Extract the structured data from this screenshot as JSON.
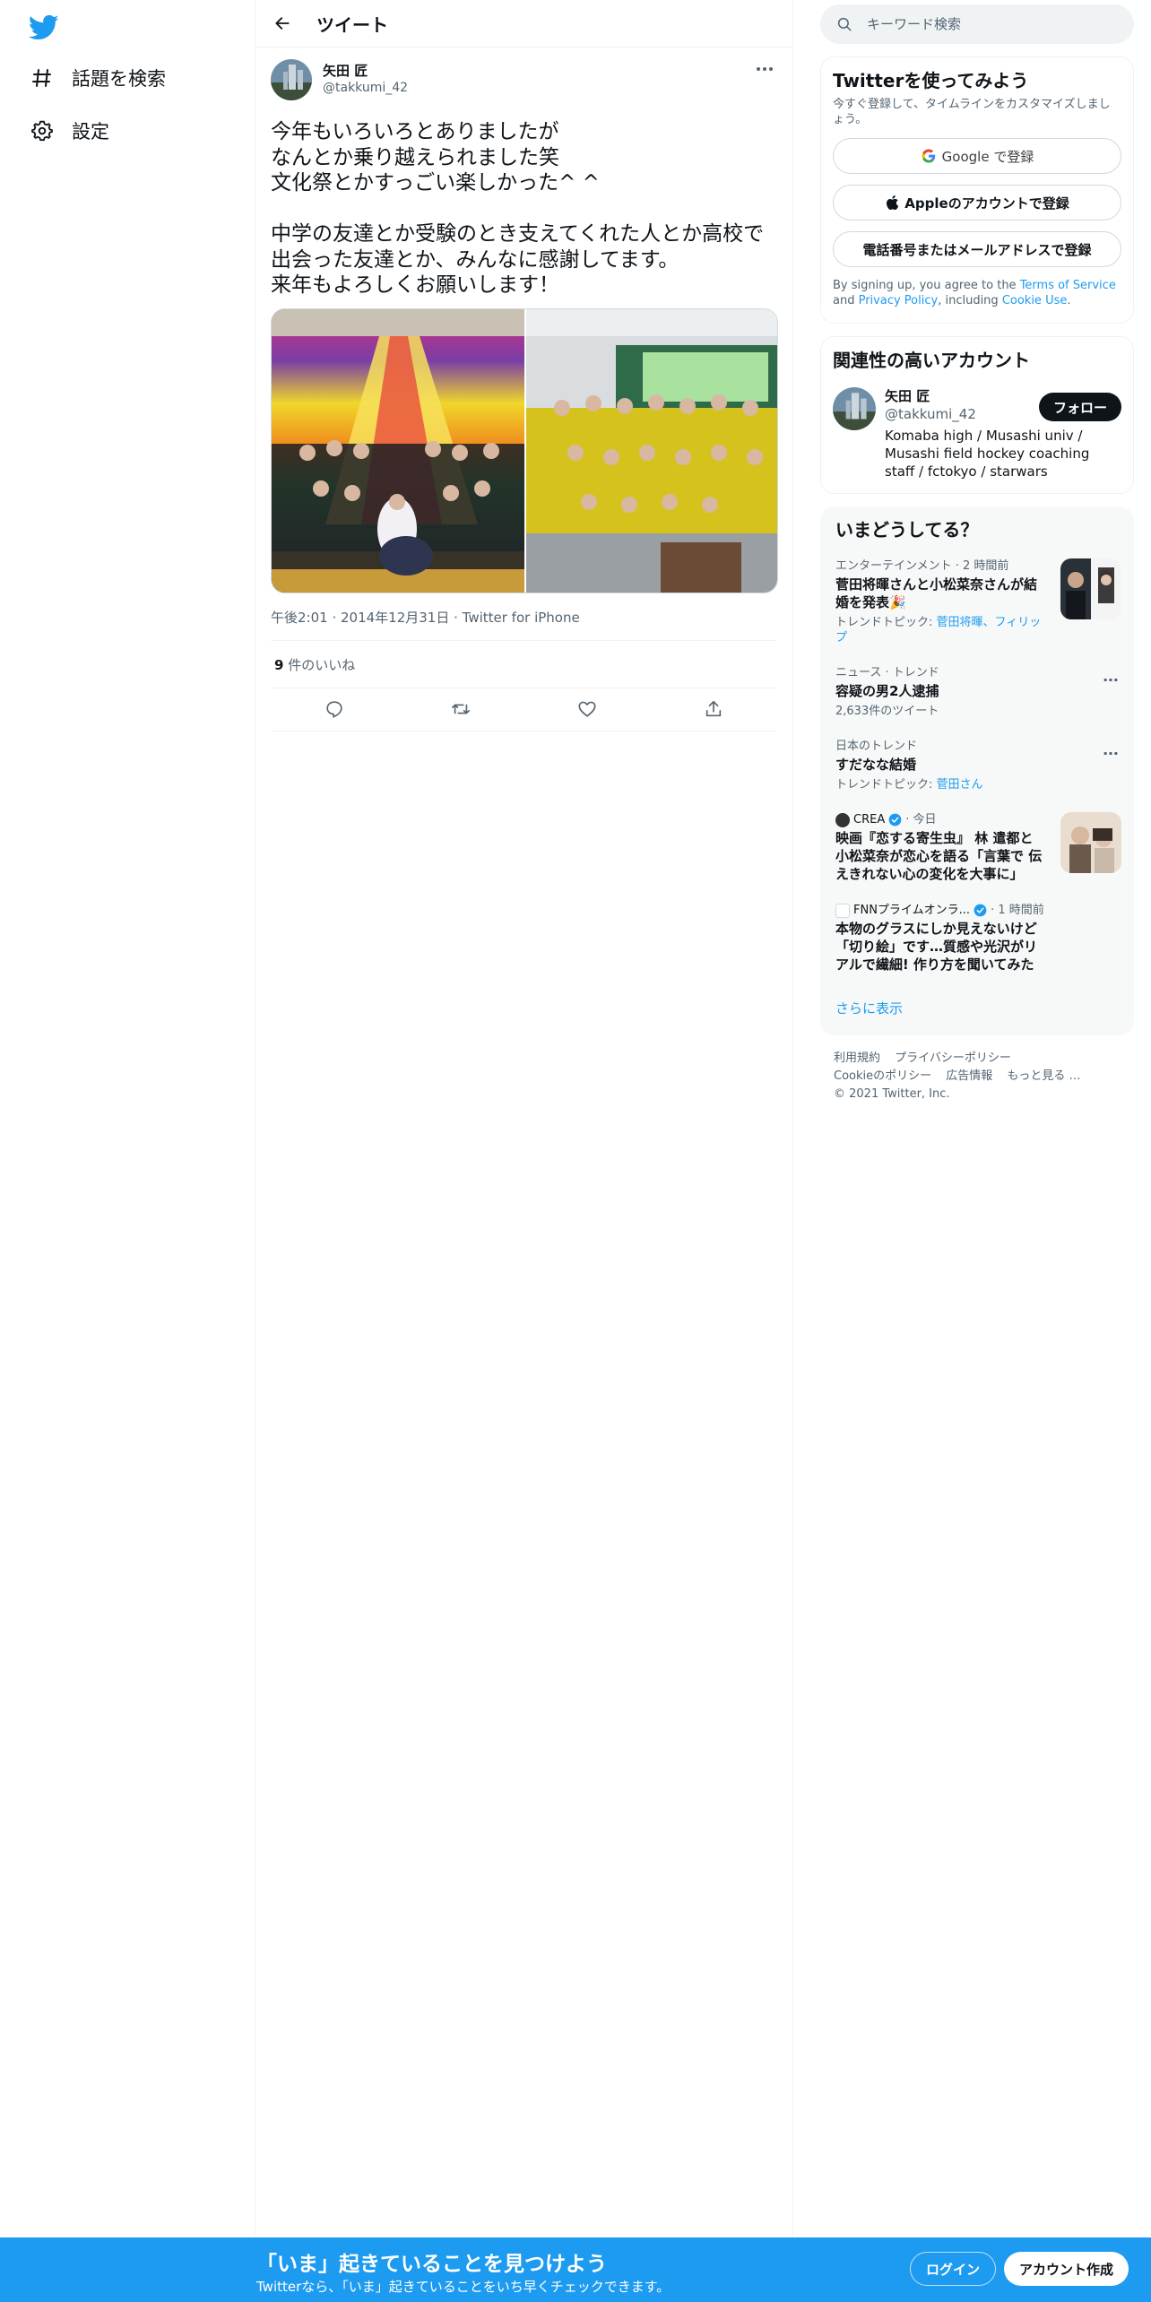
{
  "nav": {
    "logo_icon": "twitter-bird-icon",
    "items": [
      {
        "label": "話題を検索",
        "icon": "hashtag-icon"
      },
      {
        "label": "設定",
        "icon": "gear-icon"
      }
    ]
  },
  "main": {
    "header_title": "ツイート",
    "tweet": {
      "author_name": "矢田 匠",
      "author_handle": "@takkumi_42",
      "text": "今年もいろいろとありましたが\nなんとか乗り越えられました笑\n文化祭とかすっごい楽しかった^ ^\n\n中学の友達とか受験のとき支えてくれた人とか高校で出会った友達とか、みんなに感謝してます。\n来年もよろしくお願いします！",
      "timestamp": "午後2:01 · 2014年12月31日 · Twitter for iPhone",
      "likes_count": "9",
      "likes_label": " 件のいいね"
    }
  },
  "right": {
    "search_placeholder": "キーワード検索",
    "signup": {
      "title": "Twitterを使ってみよう",
      "subtitle": "今すぐ登録して、タイムラインをカスタマイズしましょう。",
      "google_label": "Google で登録",
      "apple_label": "Appleのアカウントで登録",
      "phone_label": "電話番号またはメールアドレスで登録",
      "legal_prefix": "By signing up, you agree to the ",
      "terms": "Terms of Service",
      "and": " and ",
      "privacy": "Privacy Policy",
      "including": ", including ",
      "cookie": "Cookie Use",
      "period": "."
    },
    "relevant": {
      "title": "関連性の高いアカウント",
      "name": "矢田 匠",
      "handle": "@takkumi_42",
      "bio": "Komaba high / Musashi univ / Musashi field hockey coaching staff / fctokyo / starwars",
      "follow_label": "フォロー"
    },
    "trends": {
      "title": "いまどうしてる？",
      "items": [
        {
          "category": "エンターテインメント · 2 時間前",
          "title": "菅田将暉さんと小松菜奈さんが結婚を発表🎉",
          "sub_prefix": "トレンドトピック: ",
          "sub_links": "菅田将暉、フィリップ"
        },
        {
          "category": "ニュース · トレンド",
          "title": "容疑の男2人逮捕",
          "sub": "2,633件のツイート"
        },
        {
          "category": "日本のトレンド",
          "title": "すだなな結婚",
          "sub_prefix": "トレンドトピック: ",
          "sub_links": "菅田さん"
        },
        {
          "source": "CREA",
          "time": "· 今日",
          "title": "映画『恋する寄生虫』 林 遣都と小松菜奈が恋心を語る「言葉で 伝えきれない心の変化を大事に」"
        },
        {
          "source": "FNNプライムオンラ...",
          "time": "· 1 時間前",
          "title": "本物のグラスにしか見えないけど「切り絵」です…質感や光沢がリアルで繊細! 作り方を聞いてみた"
        }
      ],
      "show_more": "さらに表示"
    },
    "footer": {
      "terms": "利用規約",
      "privacy": "プライバシーポリシー",
      "cookie": "Cookieのポリシー",
      "ads": "広告情報",
      "more": "もっと見る …",
      "copyright": "© 2021 Twitter, Inc."
    }
  },
  "bottom_bar": {
    "title": "「いま」起きていることを見つけよう",
    "subtitle": "Twitterなら、「いま」起きていることをいち早くチェックできます。",
    "login_label": "ログイン",
    "signup_label": "アカウント作成"
  },
  "colors": {
    "accent": "#1d9bf0",
    "text": "#0f1419",
    "secondary": "#536471"
  }
}
